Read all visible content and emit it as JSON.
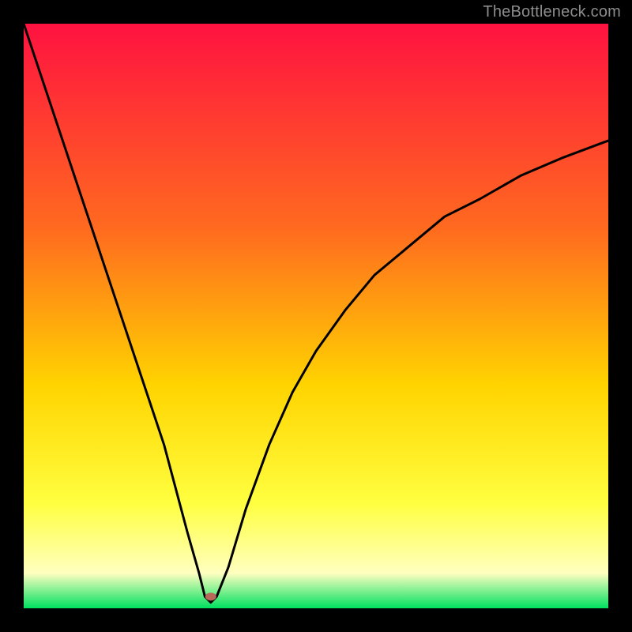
{
  "watermark": "TheBottleneck.com",
  "colors": {
    "gradient_top": "#ff1240",
    "gradient_mid1": "#ff6a1f",
    "gradient_mid2": "#ffd400",
    "gradient_mid3": "#ffff40",
    "gradient_pale": "#ffffc0",
    "gradient_bottom": "#00e060",
    "curve_stroke": "#000000",
    "marker_fill": "#b86a5a",
    "frame": "#000000"
  },
  "chart_data": {
    "type": "line",
    "title": "",
    "xlabel": "",
    "ylabel": "",
    "xlim": [
      0,
      100
    ],
    "ylim": [
      0,
      100
    ],
    "annotations": [],
    "legend": null,
    "marker": {
      "x": 32,
      "y": 2
    },
    "series": [
      {
        "name": "bottleneck-curve",
        "x": [
          0,
          4,
          8,
          12,
          16,
          20,
          24,
          28,
          30,
          31,
          32,
          33,
          35,
          38,
          42,
          46,
          50,
          55,
          60,
          66,
          72,
          78,
          85,
          92,
          100
        ],
        "y": [
          100,
          88,
          76,
          64,
          52,
          40,
          28,
          13,
          6,
          2,
          1,
          2,
          7,
          17,
          28,
          37,
          44,
          51,
          57,
          62,
          67,
          70,
          74,
          77,
          80
        ]
      }
    ]
  }
}
